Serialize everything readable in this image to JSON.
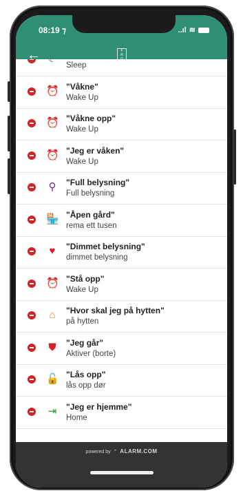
{
  "status_bar": {
    "time": "08:19 ⁊",
    "signal": "..ıl",
    "wifi": "≋"
  },
  "header": {
    "back_icon": "←",
    "logo_text": "F\nR\nG\nT"
  },
  "items": [
    {
      "title": "",
      "subtitle": "Sleep",
      "icon": "moon-icon",
      "glyph": "☾",
      "color": "#1f66c4"
    },
    {
      "title": "\"Våkne\"",
      "subtitle": "Wake Up",
      "icon": "alarm-clock-icon",
      "glyph": "⏰",
      "color": "#e3a21c"
    },
    {
      "title": "\"Våkne opp\"",
      "subtitle": "Wake Up",
      "icon": "alarm-clock-icon",
      "glyph": "⏰",
      "color": "#e3a21c"
    },
    {
      "title": "\"Jeg er våken\"",
      "subtitle": "Wake Up",
      "icon": "alarm-clock-icon",
      "glyph": "⏰",
      "color": "#e3a21c"
    },
    {
      "title": "\"Full belysning\"",
      "subtitle": "Full belysning",
      "icon": "light-bulbs-icon",
      "glyph": "⚲",
      "color": "#6a2a86"
    },
    {
      "title": "\"Åpen gård\"",
      "subtitle": "rema ett tusen",
      "icon": "storefront-icon",
      "glyph": "🏪",
      "color": "#2b63b7"
    },
    {
      "title": "\"Dimmet belysning\"",
      "subtitle": "dimmet belysning",
      "icon": "heart-icon",
      "glyph": "♥",
      "color": "#d32326"
    },
    {
      "title": "\"Stå opp\"",
      "subtitle": "Wake Up",
      "icon": "alarm-clock-icon",
      "glyph": "⏰",
      "color": "#e3a21c"
    },
    {
      "title": "\"Hvor skal jeg på hytten\"",
      "subtitle": "på hytten",
      "icon": "cabin-icon",
      "glyph": "⌂",
      "color": "#d3862a"
    },
    {
      "title": "\"Jeg går\"",
      "subtitle": "Aktiver (borte)",
      "icon": "shield-icon",
      "glyph": "⛊",
      "color": "#d32326"
    },
    {
      "title": "\"Lås opp\"",
      "subtitle": "lås opp dør",
      "icon": "unlock-icon",
      "glyph": "🔓",
      "color": "#2a9a3c"
    },
    {
      "title": "\"Jeg er hjemme\"",
      "subtitle": "Home",
      "icon": "enter-home-icon",
      "glyph": "⇥",
      "color": "#2a9a3c"
    }
  ],
  "footer": {
    "powered_by": "powered by",
    "brand": "ALARM.COM"
  }
}
